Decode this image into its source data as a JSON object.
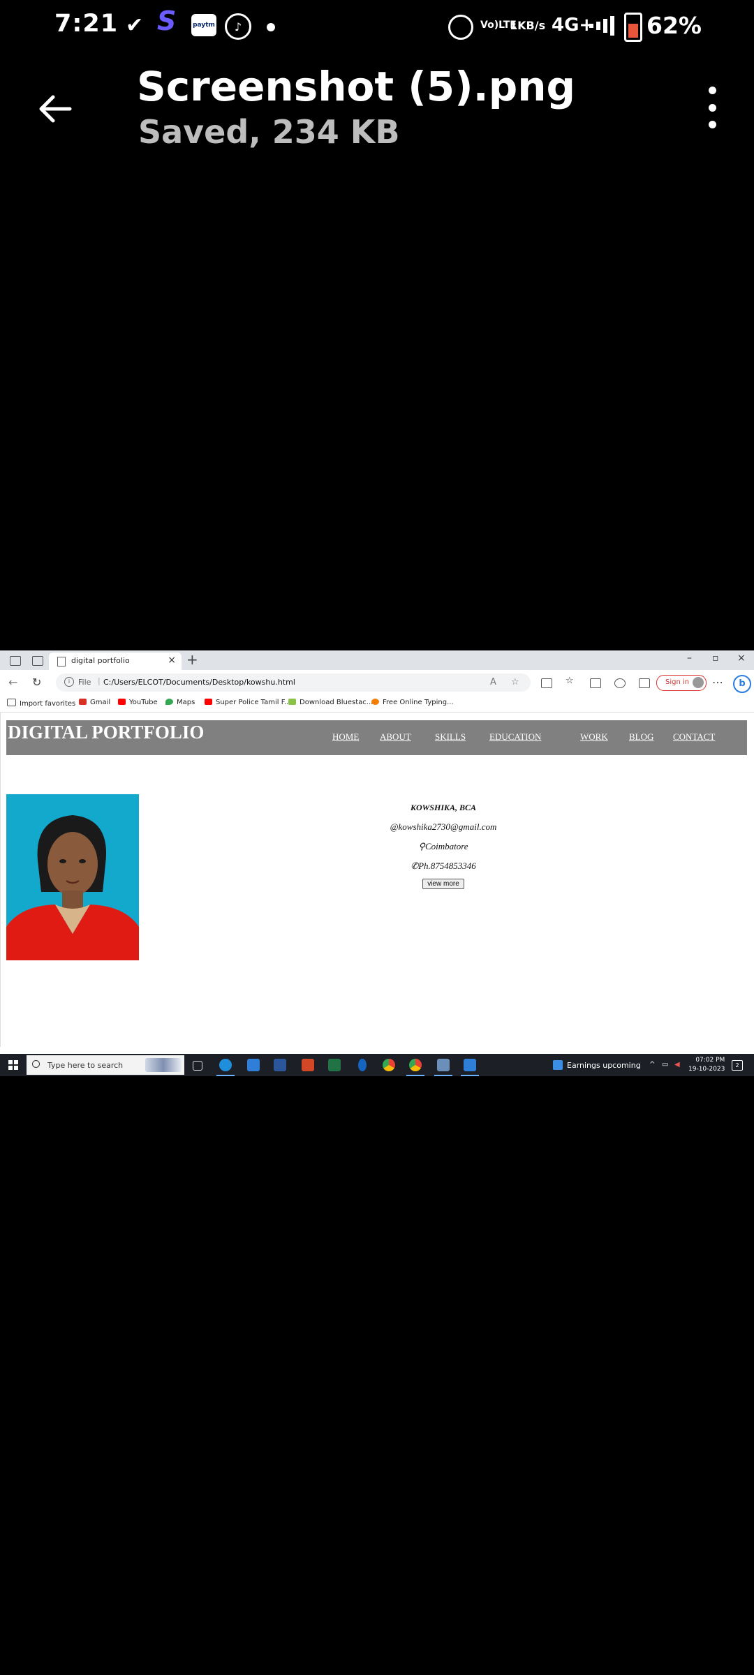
{
  "status_bar": {
    "time": "7:21",
    "network_label_1": "Vo)",
    "network_label_2": "LTE",
    "speed_value": "1",
    "speed_unit": "KB/s",
    "network_type": "4G+",
    "battery_percent": "62%",
    "battery_level": 0.62,
    "icons": [
      "check-icon",
      "s-app-icon",
      "paytm-icon",
      "music-icon",
      "dot-icon",
      "alarm-icon",
      "signal-icon",
      "battery-icon"
    ]
  },
  "viewer": {
    "title": "Screenshot (5).png",
    "subtitle": "Saved, 234 KB"
  },
  "browser": {
    "tab_title": "digital portfolio",
    "url_prefix": "File",
    "url": "C:/Users/ELCOT/Documents/Desktop/kowshu.html",
    "sign_in": "Sign in",
    "favorites": [
      {
        "label": "Import favorites",
        "color": "#555555"
      },
      {
        "label": "Gmail",
        "color": "#d93025"
      },
      {
        "label": "YouTube",
        "color": "#ff0000"
      },
      {
        "label": "Maps",
        "color": "#34a853"
      },
      {
        "label": "Super Police Tamil F...",
        "color": "#ff0000"
      },
      {
        "label": "Download Bluestac...",
        "color": "#8bc34a"
      },
      {
        "label": "Free Online Typing...",
        "color": "#f57c00"
      }
    ]
  },
  "portfolio": {
    "site_title": "DIGITAL PORTFOLIO",
    "nav": [
      "HOME",
      "ABOUT",
      "SKILLS",
      "EDUCATION",
      "WORK",
      "BLOG",
      "CONTACT"
    ],
    "name": "KOWSHIKA, BCA",
    "email": "@kowshika2730@gmail.com",
    "location": "Coimbatore",
    "phone": "Ph.8754853346",
    "view_more": "view more",
    "header_color": "#808080"
  },
  "taskbar": {
    "search_placeholder": "Type here to search",
    "widget_text": "Earnings upcoming",
    "time": "07:02 PM",
    "date": "19-10-2023",
    "notification_count": "2"
  }
}
